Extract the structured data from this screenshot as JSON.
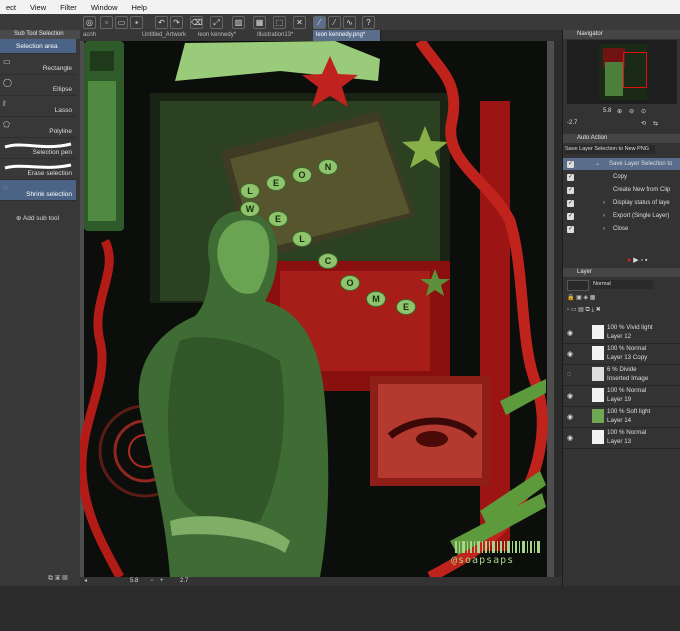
{
  "menu": [
    "ect",
    "View",
    "Filter",
    "Window",
    "Help"
  ],
  "subtool": {
    "header": "Sub Tool Selection",
    "items": [
      {
        "label": "Selection area",
        "icon": "selection-area-icon"
      },
      {
        "label": "Rectangle",
        "icon": "rectangle-icon"
      },
      {
        "label": "Ellipse",
        "icon": "ellipse-icon"
      },
      {
        "label": "Lasso",
        "icon": "lasso-icon"
      },
      {
        "label": "Polyline",
        "icon": "polyline-icon"
      },
      {
        "label": "Selection pen",
        "icon": "selection-pen-icon"
      },
      {
        "label": "Erase selection",
        "icon": "erase-selection-icon"
      },
      {
        "label": "Shrink selection",
        "icon": "shrink-selection-icon"
      }
    ],
    "add_label": "Add sub tool"
  },
  "tabs": [
    "acnh",
    "Untitled_Artwork",
    "leon kennedy*",
    "Illustration13*",
    "leon kennedy.png*"
  ],
  "status": {
    "zoom": "5.8",
    "angle": "2.7"
  },
  "navigator": {
    "title": "Navigator",
    "zoom": "5.8",
    "angle": "-2.7"
  },
  "auto_action": {
    "title": "Auto Action",
    "set": "Save Layer Selection to New PNG",
    "items": [
      "Save Layer Selection to",
      "Copy",
      "Create New from Clip",
      "Display status of laye",
      "Export (Single Layer)",
      "Close"
    ]
  },
  "layer_panel": {
    "title": "Layer",
    "blend": "Normal",
    "layers": [
      {
        "mode": "100 % Vivid light",
        "name": "Layer 12"
      },
      {
        "mode": "100 % Normal",
        "name": "Layer 13 Copy"
      },
      {
        "mode": "6 % Divide",
        "name": "Inserted Image"
      },
      {
        "mode": "100 % Normal",
        "name": "Layer 19"
      },
      {
        "mode": "100 % Soft light",
        "name": "Layer 14"
      },
      {
        "mode": "100 % Normal",
        "name": "Layer 13"
      }
    ]
  },
  "artwork": {
    "letters_row1": [
      "L",
      "E",
      "O",
      "N"
    ],
    "letters_row2": [
      "W",
      "E",
      "L",
      "C",
      "O",
      "M",
      "E"
    ],
    "handle": "@soapsaps"
  }
}
